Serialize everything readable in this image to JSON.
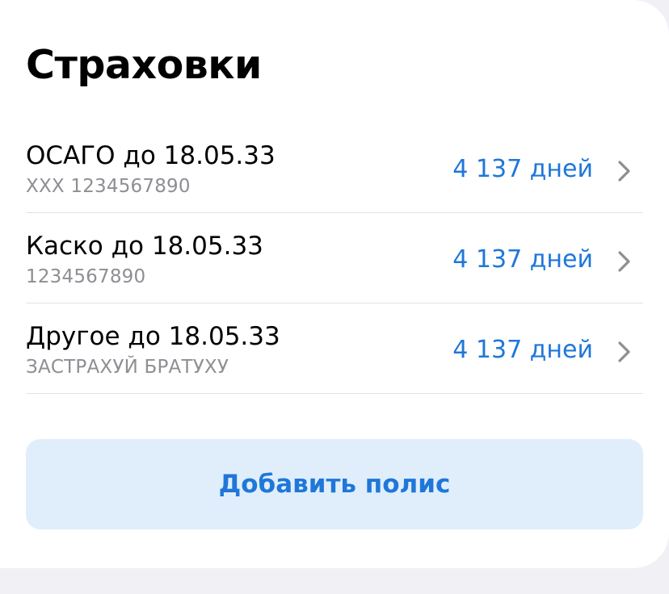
{
  "page": {
    "title": "Страховки"
  },
  "policies": [
    {
      "title": "ОСАГО до 18.05.33",
      "subtitle": "XXX 1234567890",
      "days_left": "4 137 дней",
      "icon": "chevron-right-icon"
    },
    {
      "title": "Каско до 18.05.33",
      "subtitle": "1234567890",
      "days_left": "4 137 дней",
      "icon": "chevron-right-icon"
    },
    {
      "title": "Другое до 18.05.33",
      "subtitle": "ЗАСТРАХУЙ БРАТУХУ",
      "days_left": "4 137 дней",
      "icon": "chevron-right-icon"
    }
  ],
  "actions": {
    "add_policy_label": "Добавить полис"
  },
  "colors": {
    "accent": "#1f77d8",
    "button_background": "#e0eefc",
    "secondary_text": "#8e8e93",
    "page_background": "#f0f0f5"
  }
}
